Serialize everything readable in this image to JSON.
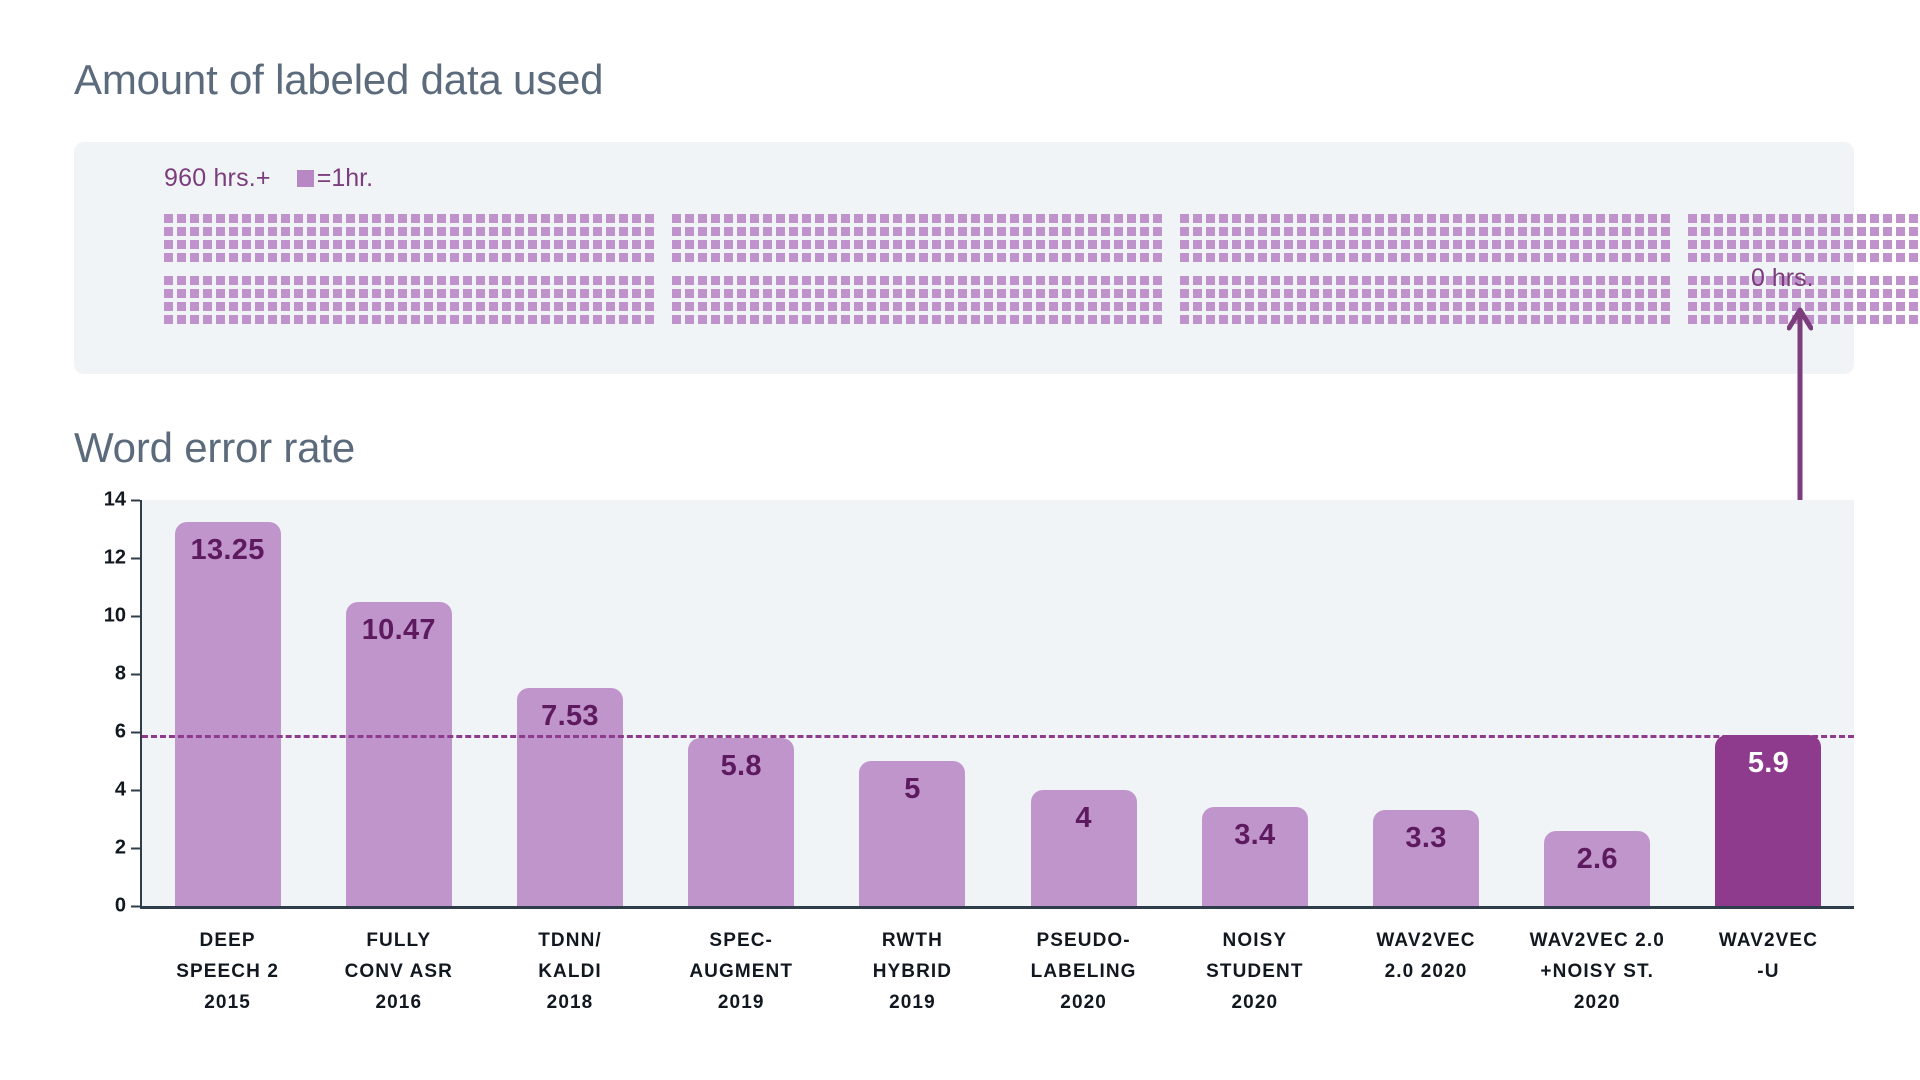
{
  "sections": {
    "labeled_data_title": "Amount of labeled data used",
    "wer_title": "Word error rate"
  },
  "legend": {
    "hours_label": "960 hrs.+",
    "unit_label": "=1hr.",
    "swatch_name": "one-hour-swatch"
  },
  "callout": {
    "zero_hours_label": "0 hrs."
  },
  "colors": {
    "panel_bg": "#f0f4f7",
    "bar": "#bf95cc",
    "bar_highlight": "#8e3b8e",
    "accent_purple": "#7b3d7b",
    "value_text": "#5e1a5e",
    "title_text": "#5b6b7c",
    "axis": "#2f3d4a",
    "dot": "#bf92cb"
  },
  "dot_matrix": {
    "block_rows": 2,
    "rows_per_block": 4,
    "groups_per_row": 4,
    "columns_per_group": 38,
    "unit_note": "each square = 1 hr."
  },
  "chart_data": {
    "type": "bar",
    "title": "Word error rate",
    "xlabel": "",
    "ylabel": "",
    "ylim": [
      0,
      14
    ],
    "yticks": [
      0,
      2,
      4,
      6,
      8,
      10,
      12,
      14
    ],
    "grid": false,
    "legend_position": "none",
    "threshold_line": 5.9,
    "categories": [
      "DEEP\nSPEECH 2\n2015",
      "FULLY\nCONV ASR\n2016",
      "TDNN/\nKALDI\n2018",
      "SPEC-\nAUGMENT\n2019",
      "RWTH\nHYBRID\n2019",
      "PSEUDO-\nLABELING\n2020",
      "NOISY\nSTUDENT\n2020",
      "WAV2VEC\n2.0 2020",
      "WAV2VEC 2.0\n+NOISY ST.\n2020",
      "WAV2VEC\n-U"
    ],
    "category_lines": [
      [
        "DEEP",
        "SPEECH 2",
        "2015"
      ],
      [
        "FULLY",
        "CONV ASR",
        "2016"
      ],
      [
        "TDNN/",
        "KALDI",
        "2018"
      ],
      [
        "SPEC-",
        "AUGMENT",
        "2019"
      ],
      [
        "RWTH",
        "HYBRID",
        "2019"
      ],
      [
        "PSEUDO-",
        "LABELING",
        "2020"
      ],
      [
        "NOISY",
        "STUDENT",
        "2020"
      ],
      [
        "WAV2VEC",
        "2.0 2020",
        ""
      ],
      [
        "WAV2VEC 2.0",
        "+NOISY ST.",
        "2020"
      ],
      [
        "WAV2VEC",
        "-U",
        ""
      ]
    ],
    "values": [
      13.25,
      10.47,
      7.53,
      5.8,
      5,
      4,
      3.4,
      3.3,
      2.6,
      5.9
    ],
    "value_labels": [
      "13.25",
      "10.47",
      "7.53",
      "5.8",
      "5",
      "4",
      "3.4",
      "3.3",
      "2.6",
      "5.9"
    ],
    "highlight_index": 9,
    "labeled_hours": [
      "960 hrs.+",
      "960 hrs.+",
      "960 hrs.+",
      "960 hrs.+",
      "960 hrs.+",
      "960 hrs.+",
      "960 hrs.+",
      "960 hrs.+",
      "960 hrs.+",
      "0 hrs."
    ]
  }
}
